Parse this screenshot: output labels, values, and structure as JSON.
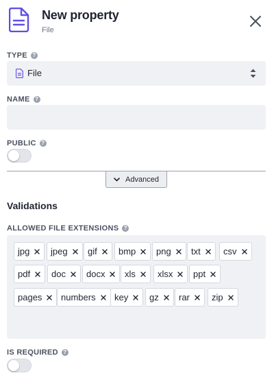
{
  "header": {
    "title": "New property",
    "subtitle": "File",
    "icon": "file-document-icon",
    "accent": "#5c4ee5"
  },
  "type_field": {
    "label": "TYPE",
    "value": "File"
  },
  "name_field": {
    "label": "NAME",
    "value": ""
  },
  "public_field": {
    "label": "PUBLIC",
    "on": false
  },
  "advanced_button": {
    "label": "Advanced"
  },
  "validations": {
    "title": "Validations",
    "extensions_label": "ALLOWED FILE EXTENSIONS",
    "extensions": [
      "jpg",
      "jpeg",
      "gif",
      "bmp",
      "png",
      "txt",
      "csv",
      "pdf",
      "doc",
      "docx",
      "xls",
      "xlsx",
      "ppt",
      "pages",
      "numbers",
      "key",
      "gz",
      "rar",
      "zip"
    ]
  },
  "required_field": {
    "label": "IS REQUIRED",
    "on": false
  }
}
